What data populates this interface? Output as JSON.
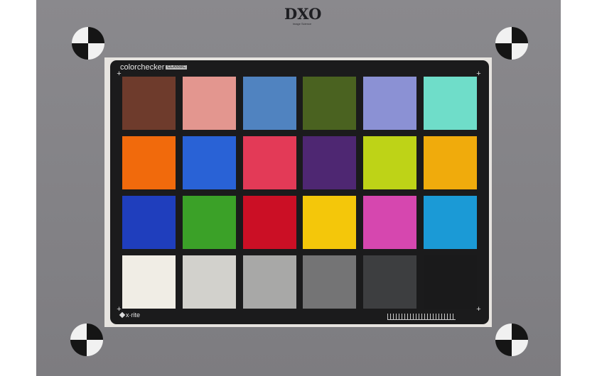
{
  "logo": {
    "text": "DXO",
    "subtext": "Image Science"
  },
  "card": {
    "title_word": "colorchecker",
    "title_badge": "CLASSIC",
    "brand": "x·rite"
  },
  "patches": [
    "#6e3b2c",
    "#e3968f",
    "#5083c0",
    "#4a6220",
    "#8b91d4",
    "#6fddc9",
    "#f16a0c",
    "#2962d6",
    "#e33a57",
    "#4e2772",
    "#bed317",
    "#f0ab0c",
    "#1f3ebd",
    "#3ba128",
    "#cb0f25",
    "#f4c70a",
    "#d647af",
    "#1b9ad6",
    "#f0ede5",
    "#d2d1cc",
    "#a8a8a7",
    "#747475",
    "#3d3e40",
    "#1a1a1b"
  ],
  "colors": {
    "board": "#848387",
    "card": "#1b1b1c",
    "mount": "#e7e4e0"
  }
}
